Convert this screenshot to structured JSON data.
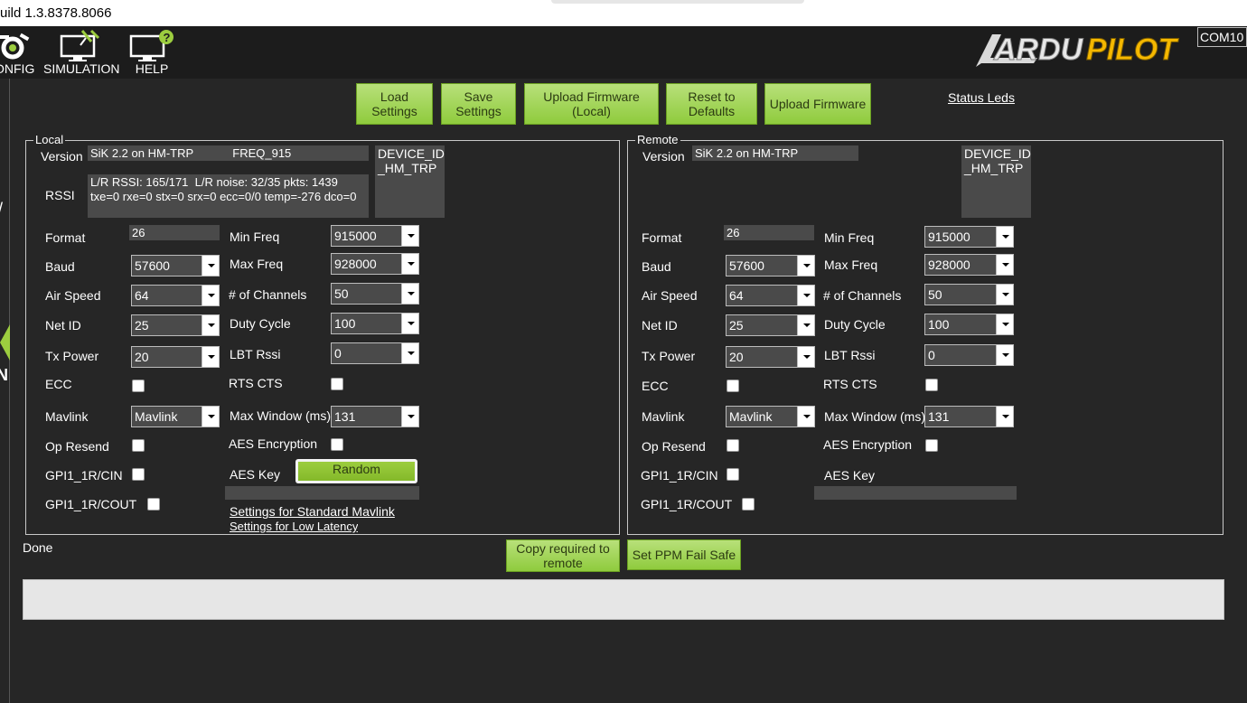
{
  "window": {
    "title": "uild 1.3.8378.8066"
  },
  "menu": {
    "items": [
      {
        "label": "ONFIG",
        "icon": "config-gear-icon"
      },
      {
        "label": "SIMULATION",
        "icon": "simulation-monitor-icon"
      },
      {
        "label": "HELP",
        "icon": "help-monitor-icon"
      }
    ],
    "logo": "ARDUPILOT",
    "port": "COM10"
  },
  "leftstrip": {
    "glyph1": "/",
    "glyph2": "N"
  },
  "toolbar": {
    "load_settings": "Load\nSettings",
    "save_settings": "Save\nSettings",
    "upload_firmware_local": "Upload Firmware\n(Local)",
    "reset_defaults": "Reset to\nDefaults",
    "upload_firmware": "Upload Firmware",
    "status_leds": "Status Leds"
  },
  "local": {
    "group_title": "Local",
    "version_label": "Version",
    "version_value": "SiK 2.2 on HM-TRP            FREQ_915",
    "device_id": "DEVICE_ID\n_HM_TRP",
    "rssi_label": "RSSI",
    "rssi_value": "L/R RSSI: 165/171  L/R noise: 32/35 pkts: 1439\ntxe=0 rxe=0 stx=0 srx=0 ecc=0/0 temp=-276 dco=0",
    "format_label": "Format",
    "format_value": "26",
    "baud_label": "Baud",
    "baud_value": "57600",
    "airspeed_label": "Air Speed",
    "airspeed_value": "64",
    "netid_label": "Net ID",
    "netid_value": "25",
    "txpower_label": "Tx Power",
    "txpower_value": "20",
    "ecc_label": "ECC",
    "mavlink_label": "Mavlink",
    "mavlink_value": "Mavlink",
    "opresend_label": "Op Resend",
    "gpi_cin_label": "GPI1_1R/CIN",
    "gpi_cout_label": "GPI1_1R/COUT",
    "minfreq_label": "Min Freq",
    "minfreq_value": "915000",
    "maxfreq_label": "Max Freq",
    "maxfreq_value": "928000",
    "channels_label": "# of Channels",
    "channels_value": "50",
    "duty_label": "Duty Cycle",
    "duty_value": "100",
    "lbt_label": "LBT Rssi",
    "lbt_value": "0",
    "rtscts_label": "RTS CTS",
    "maxwindow_label": "Max Window (ms)",
    "maxwindow_value": "131",
    "aes_enc_label": "AES Encryption",
    "aes_key_label": "AES Key",
    "random_label": "Random",
    "aes_key_value": "",
    "std_mavlink_link": "Settings for Standard Mavlink",
    "low_latency_link": "Settings for Low Latency"
  },
  "remote": {
    "group_title": "Remote",
    "version_label": "Version",
    "version_value": "SiK 2.2 on HM-TRP",
    "device_id": "DEVICE_ID\n_HM_TRP",
    "format_label": "Format",
    "format_value": "26",
    "baud_label": "Baud",
    "baud_value": "57600",
    "airspeed_label": "Air Speed",
    "airspeed_value": "64",
    "netid_label": "Net ID",
    "netid_value": "25",
    "txpower_label": "Tx Power",
    "txpower_value": "20",
    "ecc_label": "ECC",
    "mavlink_label": "Mavlink",
    "mavlink_value": "Mavlink",
    "opresend_label": "Op Resend",
    "gpi_cin_label": "GPI1_1R/CIN",
    "gpi_cout_label": "GPI1_1R/COUT",
    "minfreq_label": "Min Freq",
    "minfreq_value": "915000",
    "maxfreq_label": "Max Freq",
    "maxfreq_value": "928000",
    "channels_label": "# of Channels",
    "channels_value": "50",
    "duty_label": "Duty Cycle",
    "duty_value": "100",
    "lbt_label": "LBT Rssi",
    "lbt_value": "0",
    "rtscts_label": "RTS CTS",
    "maxwindow_label": "Max Window (ms)",
    "maxwindow_value": "131",
    "aes_enc_label": "AES Encryption",
    "aes_key_label": "AES Key",
    "aes_key_value": ""
  },
  "status": {
    "done": "Done",
    "copy_remote": "Copy required to\nremote",
    "ppm_failsafe": "Set PPM Fail Safe",
    "log": ""
  },
  "colors": {
    "button_green": "#9ccd3f",
    "background": "#262626",
    "field": "#4a4a4a"
  }
}
